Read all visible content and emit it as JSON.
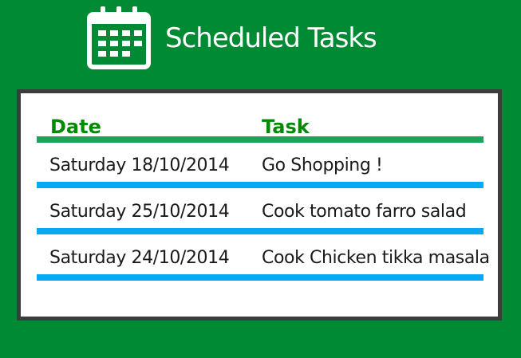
{
  "header": {
    "title": "Scheduled Tasks",
    "icon": "calendar-icon"
  },
  "table": {
    "columns": {
      "date": "Date",
      "task": "Task"
    },
    "rows": [
      {
        "date": "Saturday 18/10/2014",
        "task": "Go Shopping !"
      },
      {
        "date": "Saturday 25/10/2014",
        "task": "Cook tomato farro salad"
      },
      {
        "date": "Saturday 24/10/2014",
        "task": "Cook Chicken tikka masala"
      }
    ]
  },
  "colors": {
    "background": "#008a34",
    "panel": "#ffffff",
    "panel_border": "#3c3c3c",
    "header_text": "#008a00",
    "header_rule": "#1fa15a",
    "row_rule": "#06a9f4"
  }
}
